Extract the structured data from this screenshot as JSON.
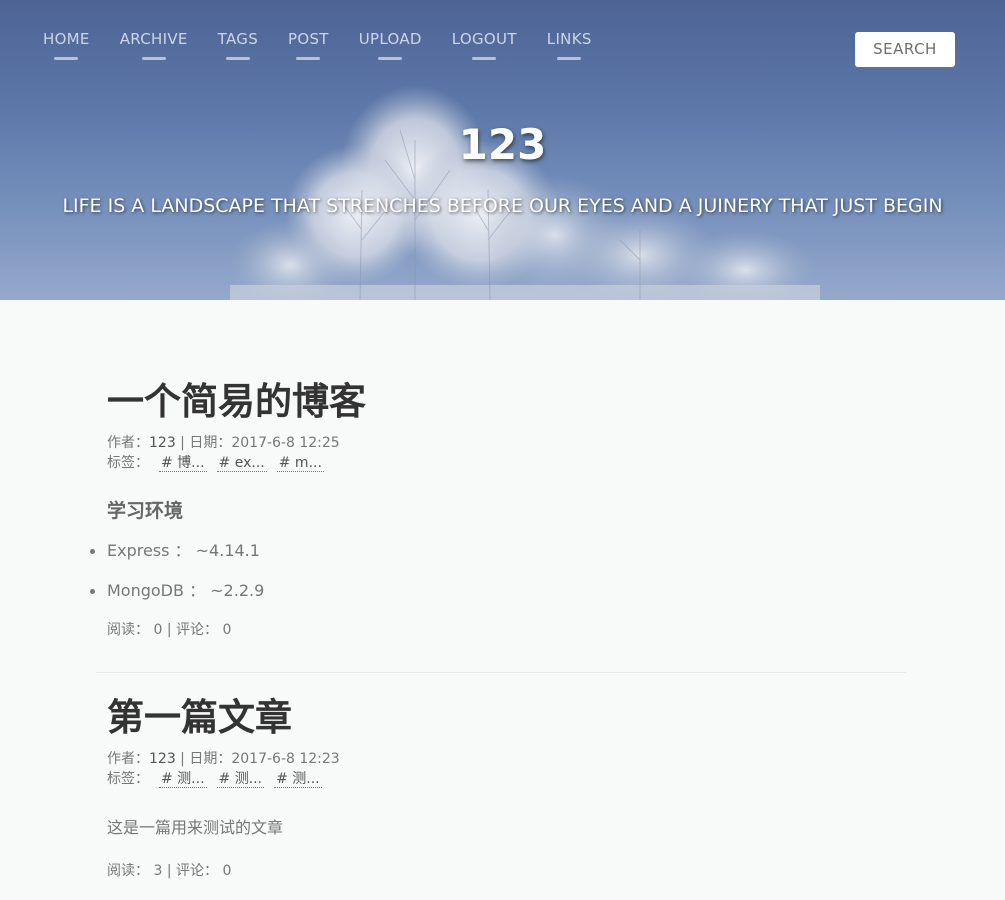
{
  "nav": {
    "items": [
      {
        "label": "HOME"
      },
      {
        "label": "ARCHIVE"
      },
      {
        "label": "TAGS"
      },
      {
        "label": "POST"
      },
      {
        "label": "UPLOAD"
      },
      {
        "label": "LOGOUT"
      },
      {
        "label": "LINKS"
      }
    ],
    "search_label": "SEARCH"
  },
  "hero": {
    "title": "123",
    "subtitle": "LIFE IS A LANDSCAPE THAT STRENCHES BEFORE OUR EYES AND A JUINERY THAT JUST BEGIN"
  },
  "posts": [
    {
      "title": "一个简易的博客",
      "author_label": "作者：",
      "author": "123",
      "date_sep": " | 日期：",
      "date": "2017-6-8 12:25",
      "tags_label": "标签：",
      "tags": [
        "# 博...",
        "# ex...",
        "# m..."
      ],
      "section_heading": "学习环境",
      "list": [
        "Express ： ~4.14.1",
        "MongoDB ： ~2.2.9"
      ],
      "reads_label": "阅读：",
      "reads": "0",
      "comments_label": " | 评论：",
      "comments": "0"
    },
    {
      "title": "第一篇文章",
      "author_label": "作者：",
      "author": "123",
      "date_sep": " | 日期：",
      "date": "2017-6-8 12:23",
      "tags_label": "标签：",
      "tags": [
        "# 测...",
        "# 测...",
        "# 测..."
      ],
      "body": "这是一篇用来测试的文章",
      "reads_label": "阅读：",
      "reads": "3",
      "comments_label": " | 评论：",
      "comments": "0"
    }
  ]
}
